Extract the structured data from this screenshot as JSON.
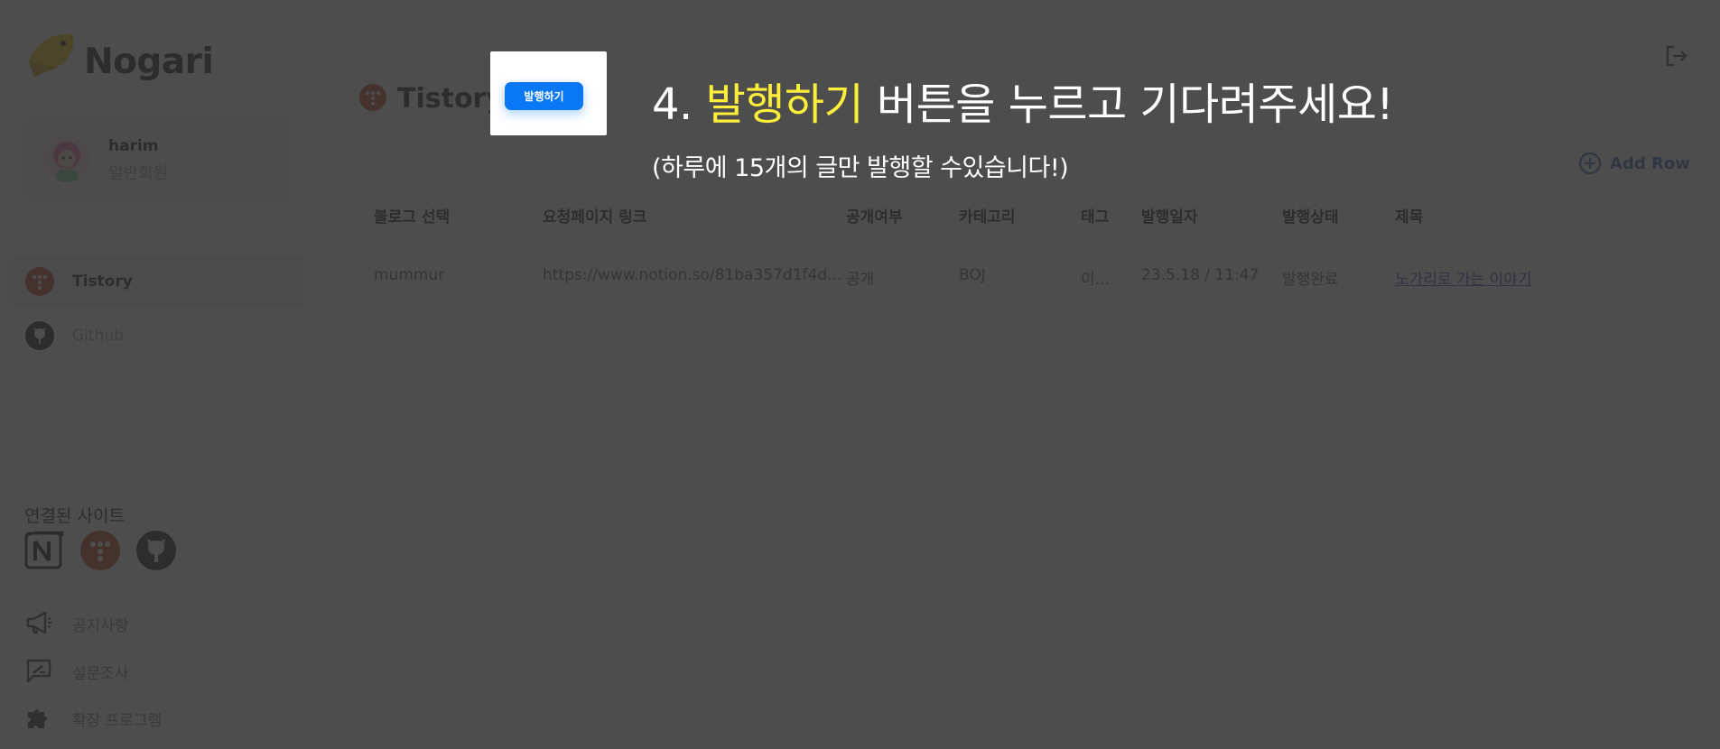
{
  "app": {
    "brand": "Nogari"
  },
  "profile": {
    "name": "harim",
    "role": "일반회원"
  },
  "nav": [
    {
      "label": "Tistory",
      "icon": "tistory-icon",
      "active": true
    },
    {
      "label": "Github",
      "icon": "github-icon",
      "active": false
    }
  ],
  "connected": {
    "title": "연결된 사이트",
    "sites": [
      "notion-icon",
      "tistory-icon",
      "github-icon"
    ]
  },
  "menu": [
    {
      "label": "공지사항",
      "icon": "megaphone-icon"
    },
    {
      "label": "설문조사",
      "icon": "survey-icon"
    },
    {
      "label": "확장 프로그램",
      "icon": "puzzle-icon"
    }
  ],
  "page": {
    "title": "Tistory",
    "add_row": "Add Row"
  },
  "table": {
    "headers": [
      "블로그 선택",
      "요청페이지 링크",
      "공개여부",
      "카테고리",
      "태그",
      "발행일자",
      "발행상태",
      "제목"
    ],
    "rows": [
      [
        "mummur",
        "https://www.notion.so/81ba357d1f4d...",
        "공개",
        "BOJ",
        "이...",
        "23.5.18 / 11:47",
        "발행완료",
        "노가리로 가는 이야기"
      ]
    ]
  },
  "guide": {
    "step_prefix": "4. ",
    "highlight": "발행하기",
    "rest": " 버튼을 누르고 기다려주세요!",
    "note": "(하루에 15개의 글만 발행할 수있습니다!)",
    "button_label": "발행하기"
  },
  "colors": {
    "accent": "#0a78f5",
    "highlight": "#ffef3a",
    "tistory": "#c2411d",
    "link": "#4a3db8"
  }
}
